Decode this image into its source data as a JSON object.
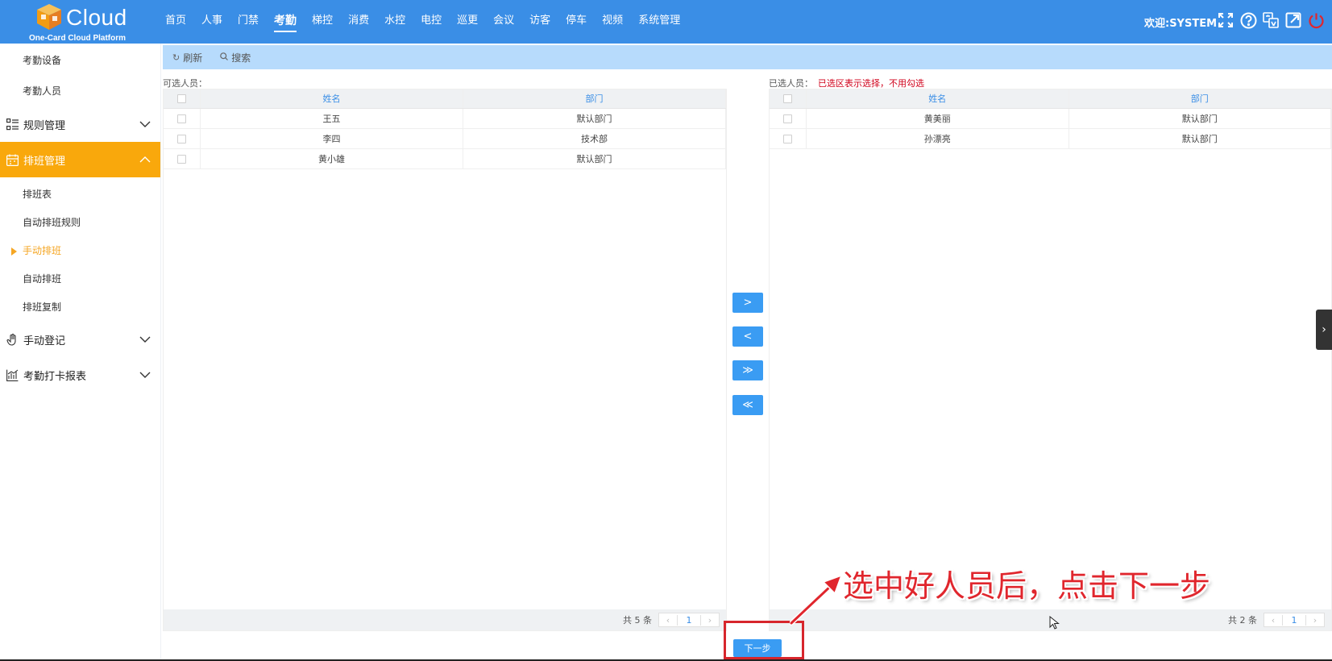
{
  "app": {
    "logo_text": "Cloud",
    "logo_subtitle": "One-Card Cloud Platform",
    "welcome": "欢迎:SYSTEM",
    "accent_color": "#3a8ee6",
    "sidebar_active_color": "#f9a80c"
  },
  "nav": {
    "items": [
      "首页",
      "人事",
      "门禁",
      "考勤",
      "梯控",
      "消费",
      "水控",
      "电控",
      "巡更",
      "会议",
      "访客",
      "停车",
      "视频",
      "系统管理"
    ],
    "active": "考勤"
  },
  "top_icons": [
    "fullscreen-icon",
    "help-icon",
    "language-icon",
    "external-link-icon",
    "power-icon"
  ],
  "sidebar": {
    "top_items": [
      "考勤设备",
      "考勤人员"
    ],
    "group_rules": "规则管理",
    "group_schedule": "排班管理",
    "schedule_items": [
      "排班表",
      "自动排班规则",
      "手动排班",
      "自动排班",
      "排班复制"
    ],
    "schedule_current": "手动排班",
    "group_manual": "手动登记",
    "group_report": "考勤打卡报表"
  },
  "toolbar": {
    "refresh": "刷新",
    "search": "搜索"
  },
  "left_panel": {
    "label": "可选人员：",
    "columns": [
      "姓名",
      "部门"
    ],
    "rows": [
      {
        "name": "王五",
        "dept": "默认部门"
      },
      {
        "name": "李四",
        "dept": "技术部"
      },
      {
        "name": "黄小雄",
        "dept": "默认部门"
      }
    ],
    "total": "共 5 条",
    "page": "1"
  },
  "right_panel": {
    "label": "已选人员：",
    "hint": "已选区表示选择，不用勾选",
    "columns": [
      "姓名",
      "部门"
    ],
    "rows": [
      {
        "name": "黄美丽",
        "dept": "默认部门"
      },
      {
        "name": "孙漂亮",
        "dept": "默认部门"
      }
    ],
    "total": "共 2 条",
    "page": "1"
  },
  "transfer_buttons": [
    ">",
    "<",
    "≫",
    "≪"
  ],
  "next_button": "下一步",
  "annotation": "选中好人员后，点击下一步"
}
